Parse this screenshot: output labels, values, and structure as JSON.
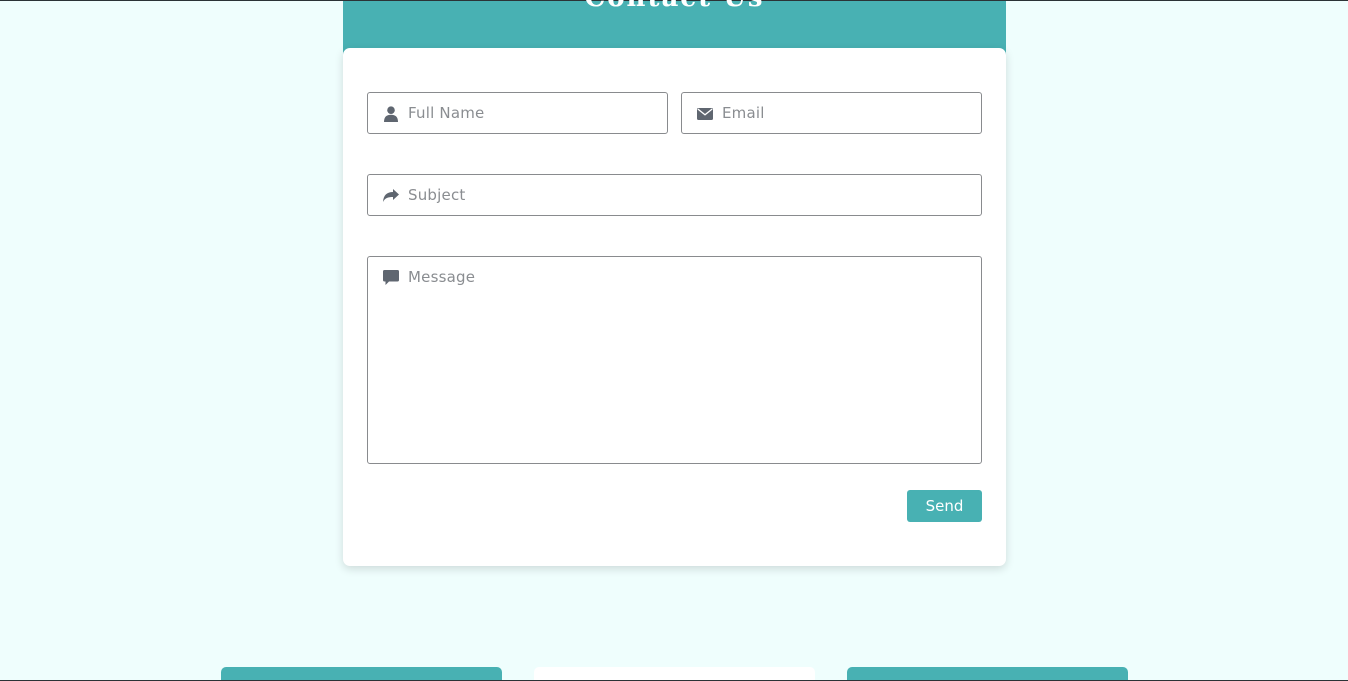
{
  "contact": {
    "heading": "Contact Us",
    "fields": {
      "full_name_placeholder": "Full Name",
      "email_placeholder": "Email",
      "subject_placeholder": "Subject",
      "message_placeholder": "Message"
    },
    "icons": {
      "full_name": "user-icon",
      "email": "envelope-icon",
      "subject": "share-arrow-icon",
      "message": "comment-icon"
    },
    "send_label": "Send"
  },
  "colors": {
    "accent": "#48b1b3",
    "page_background": "#effefd",
    "card_background": "#ffffff",
    "placeholder_text": "#8a8d91",
    "icon": "#5f6670"
  }
}
